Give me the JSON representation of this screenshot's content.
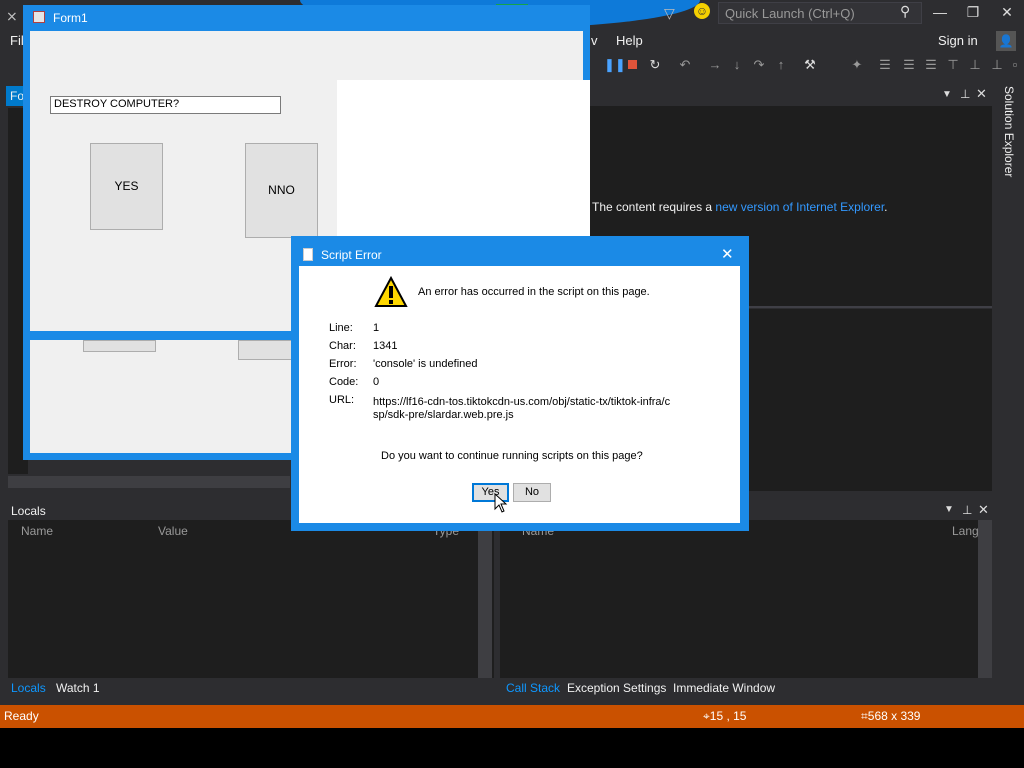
{
  "vs": {
    "quick_launch_placeholder": "Quick Launch (Ctrl+Q)",
    "menu_file_partial": "Fil",
    "menu_view_partial": "v",
    "menu_help": "Help",
    "sign_in": "Sign in",
    "tab_partial": "Fo",
    "browser_message": "The content requires a ",
    "browser_link": "new version of Internet Explorer",
    "browser_period": ".",
    "solution_explorer": "Solution Explorer",
    "locals": {
      "title": "Locals",
      "col_name": "Name",
      "col_value": "Value",
      "col_type": "Type",
      "tab_locals": "Locals",
      "tab_watch": "Watch 1"
    },
    "callstack": {
      "col_name": "Name",
      "col_lang": "Lang",
      "tab_callstack": "Call Stack",
      "tab_exceptions": "Exception Settings",
      "tab_immediate": "Immediate Window"
    },
    "status": {
      "ready": "Ready",
      "position": "15 , 15",
      "size": "568 x 339"
    },
    "accent_color": "#0e7ad9",
    "status_color": "#ca5100"
  },
  "form1": {
    "title": "Form1",
    "textbox_value": "DESTROY COMPUTER?",
    "yes_label": "YES",
    "no_label": "NNO"
  },
  "script_error": {
    "title": "Script Error",
    "message": "An error has occurred in the script on this page.",
    "fields": [
      {
        "label": "Line:",
        "value": "1"
      },
      {
        "label": "Char:",
        "value": "1341"
      },
      {
        "label": "Error:",
        "value": "'console' is undefined"
      },
      {
        "label": "Code:",
        "value": "0"
      },
      {
        "label": "URL:",
        "value": "https://lf16-cdn-tos.tiktokcdn-us.com/obj/static-tx/tiktok-infra/csp/sdk-pre/slardar.web.pre.js"
      }
    ],
    "question": "Do you want to continue running scripts on this page?",
    "yes_label": "Yes",
    "no_label": "No",
    "icon": "warning-icon"
  }
}
